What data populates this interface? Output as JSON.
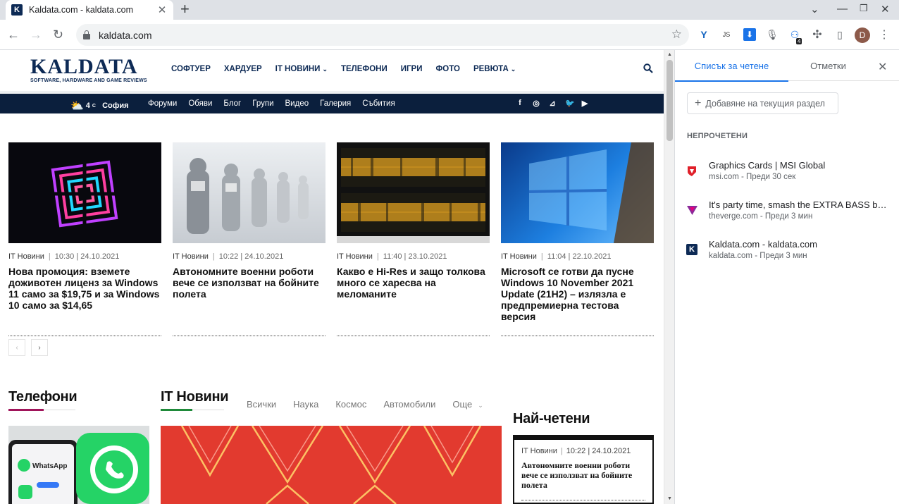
{
  "browser": {
    "tab_title": "Kaldata.com - kaldata.com",
    "tab_favicon_letter": "K",
    "url": "kaldata.com",
    "avatar_initial": "D",
    "ext_badge": "4",
    "ext_js_label": "JS"
  },
  "site": {
    "logo_text": "KALDATA",
    "logo_tagline": "SOFTWARE, HARDWARE AND GAME REVIEWS",
    "nav": [
      "СОФТУЕР",
      "ХАРДУЕР",
      "IT НОВИНИ",
      "ТЕЛЕФОНИ",
      "ИГРИ",
      "ФОТО",
      "РЕВЮТА"
    ],
    "weather_temp": "4",
    "weather_unit": "C",
    "weather_city": "София",
    "sublinks": [
      "Форуми",
      "Обяви",
      "Блог",
      "Групи",
      "Видео",
      "Галерия",
      "Събития"
    ],
    "articles": [
      {
        "category": "IT Новини",
        "time": "10:30 | 24.10.2021",
        "title": "Нова промоция: вземете доживотен лиценз за Windows 11 само за $19,75 и за Windows 10 само за $14,65"
      },
      {
        "category": "IT Новини",
        "time": "10:22 | 24.10.2021",
        "title": "Автономните военни роботи вече се използват на бойните полета"
      },
      {
        "category": "IT Новини",
        "time": "11:40 | 23.10.2021",
        "title": "Какво е Hi-Res и защо толкова много се харесва на меломаните"
      },
      {
        "category": "IT Новини",
        "time": "11:04 | 22.10.2021",
        "title": "Microsoft се готви да пусне Windows 10 November 2021 Update (21H2) – излязла е предпремиерна тестова версия"
      }
    ],
    "phones_title": "Телефони",
    "it_news_title": "IT Новини",
    "subtabs": [
      "Всички",
      "Наука",
      "Космос",
      "Автомобили",
      "Още"
    ],
    "most_read_title": "Най-четени",
    "most_read": {
      "category": "IT Новини",
      "time": "10:22 | 24.10.2021",
      "title": "Автономните военни роботи вече се използват на бойните полета"
    },
    "whatsapp_label": "WhatsApp"
  },
  "panel": {
    "tab_reading_list": "Списък за четене",
    "tab_bookmarks": "Отметки",
    "add_button": "Добавяне на текущия раздел",
    "section_unread": "НЕПРОЧЕТЕНИ",
    "items": [
      {
        "title": "Graphics Cards | MSI Global",
        "sub": "msi.com - Преди 30 сек",
        "icon": "msi-icon"
      },
      {
        "title": "It's party time, smash the EXTRA BASS button",
        "sub": "theverge.com - Преди 3 мин",
        "icon": "verge-icon"
      },
      {
        "title": "Kaldata.com - kaldata.com",
        "sub": "kaldata.com - Преди 3 мин",
        "icon": "kaldata-icon"
      }
    ]
  },
  "colors": {
    "accent": "#1a73e8",
    "brand": "#0d2a55",
    "bar": "#0b1f3d",
    "phones_underline": "#a0145a",
    "it_underline": "#1f8a3a"
  }
}
